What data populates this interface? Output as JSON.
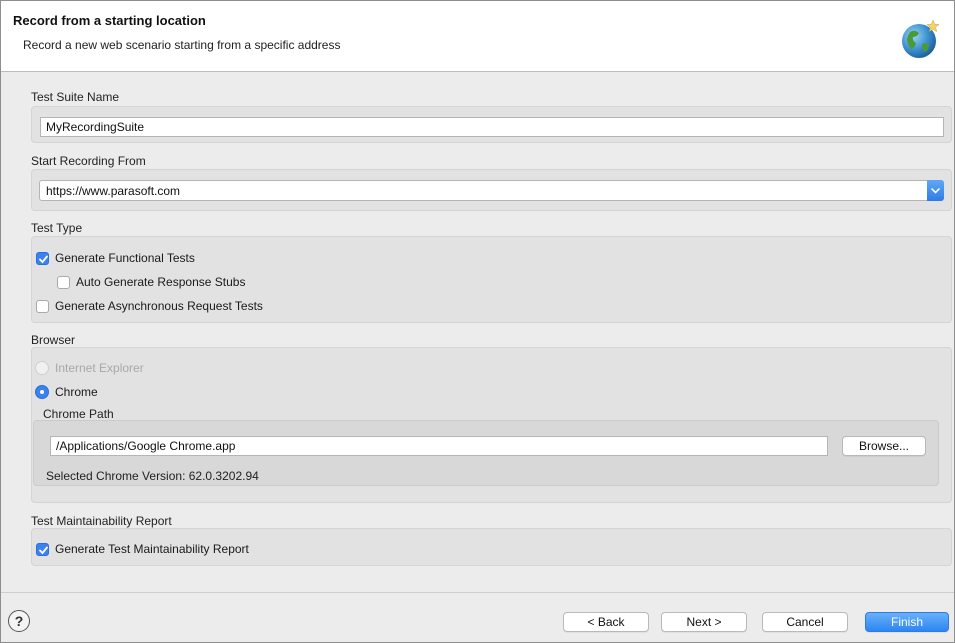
{
  "header": {
    "title": "Record from a starting location",
    "description": "Record a new web scenario starting from a specific address",
    "icon": "globe-wizard-icon"
  },
  "test_suite": {
    "label": "Test Suite Name",
    "value": "MyRecordingSuite"
  },
  "start_recording": {
    "label": "Start Recording From",
    "value": "https://www.parasoft.com"
  },
  "test_type": {
    "label": "Test Type",
    "functional": {
      "label": "Generate Functional Tests",
      "checked": true
    },
    "stubs": {
      "label": "Auto Generate Response Stubs",
      "checked": false
    },
    "async": {
      "label": "Generate Asynchronous Request Tests",
      "checked": false
    }
  },
  "browser": {
    "label": "Browser",
    "ie_label": "Internet Explorer",
    "chrome_label": "Chrome",
    "chrome_path_label": "Chrome Path",
    "chrome_path_value": "/Applications/Google Chrome.app",
    "browse_label": "Browse...",
    "version_text": "Selected Chrome Version: 62.0.3202.94"
  },
  "maintainability": {
    "label": "Test Maintainability Report",
    "checkbox_label": "Generate Test Maintainability Report",
    "checked": true
  },
  "footer": {
    "help": "?",
    "back": "< Back",
    "next": "Next >",
    "cancel": "Cancel",
    "finish": "Finish"
  },
  "colors": {
    "accent": "#3b82f0",
    "panel": "#e2e2e2",
    "header_bg": "#ffffff"
  }
}
